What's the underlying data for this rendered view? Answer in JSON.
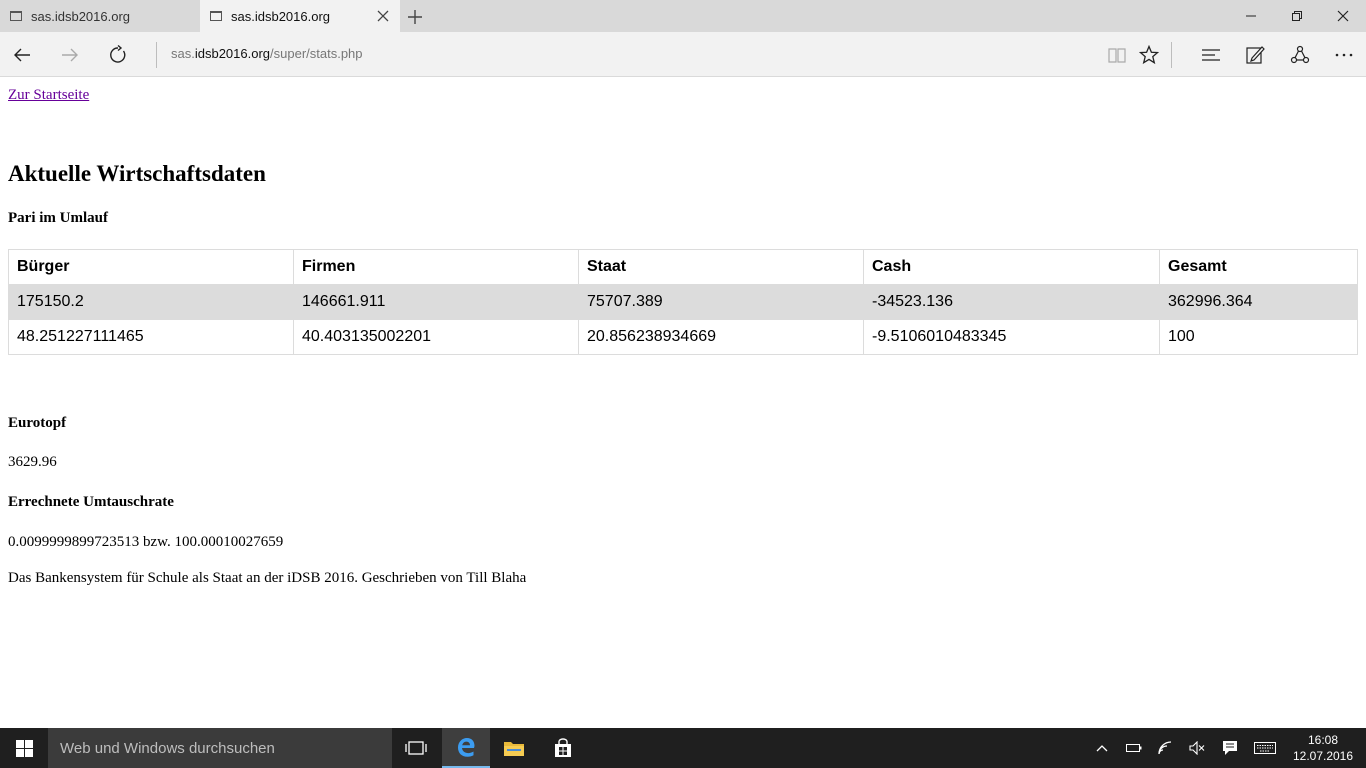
{
  "browser": {
    "tabs": [
      {
        "label": "sas.idsb2016.org",
        "active": false
      },
      {
        "label": "sas.idsb2016.org",
        "active": true
      }
    ],
    "address": {
      "prefix": "sas.",
      "host": "idsb2016.org",
      "path": "/super/stats.php"
    }
  },
  "page": {
    "home_link": "Zur Startseite",
    "title": "Aktuelle Wirtschaftsdaten",
    "circulation_heading": "Pari im Umlauf",
    "table": {
      "headers": [
        "Bürger",
        "Firmen",
        "Staat",
        "Cash",
        "Gesamt"
      ],
      "rows": [
        [
          "175150.2",
          "146661.911",
          "75707.389",
          "-34523.136",
          "362996.364"
        ],
        [
          "48.251227111465",
          "40.403135002201",
          "20.856238934669",
          "-9.5106010483345",
          "100"
        ]
      ]
    },
    "eurotopf_heading": "Eurotopf",
    "eurotopf_value": "3629.96",
    "rate_heading": "Errechnete Umtauschrate",
    "rate_value": "0.0099999899723513 bzw. 100.00010027659",
    "footer": "Das Bankensystem für Schule als Staat an der iDSB 2016. Geschrieben von Till Blaha"
  },
  "taskbar": {
    "search_placeholder": "Web und Windows durchsuchen",
    "time": "16:08",
    "date": "12.07.2016",
    "accent_color": "#76b9ed"
  }
}
